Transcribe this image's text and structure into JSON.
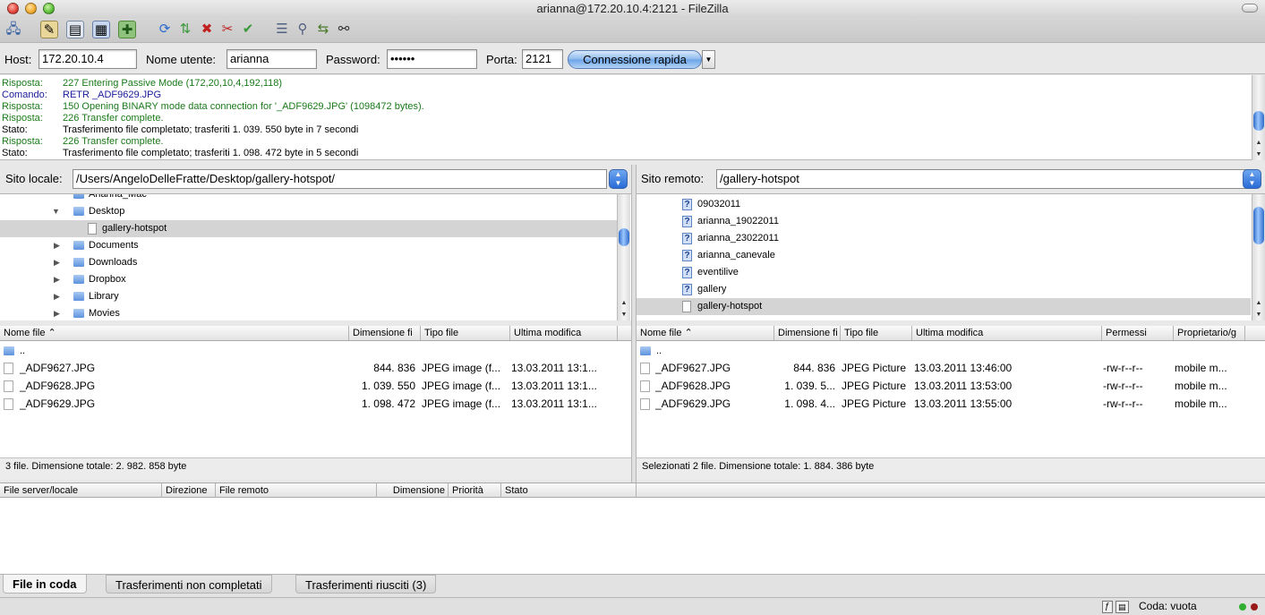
{
  "window": {
    "title": "arianna@172.20.10.4:2121 - FileZilla"
  },
  "quickconnect": {
    "host_label": "Host:",
    "host_value": "172.20.10.4",
    "user_label": "Nome utente:",
    "user_value": "arianna",
    "password_label": "Password:",
    "password_value": "••••••",
    "port_label": "Porta:",
    "port_value": "2121",
    "connect_label": "Connessione rapida"
  },
  "log": [
    {
      "type": "Risposta:",
      "text": "227 Entering Passive Mode (172,20,10,4,192,118)",
      "color": "#1a7a1a"
    },
    {
      "type": "Comando:",
      "text": "RETR _ADF9629.JPG",
      "color": "#1a1a9a"
    },
    {
      "type": "Risposta:",
      "text": "150 Opening BINARY mode data connection for '_ADF9629.JPG' (1098472 bytes).",
      "color": "#1a7a1a"
    },
    {
      "type": "Risposta:",
      "text": "226 Transfer complete.",
      "color": "#1a7a1a"
    },
    {
      "type": "Stato:",
      "text": "Trasferimento file completato; trasferiti 1. 039. 550 byte in 7 secondi",
      "color": "#000000"
    },
    {
      "type": "Risposta:",
      "text": "226 Transfer complete.",
      "color": "#1a7a1a"
    },
    {
      "type": "Stato:",
      "text": "Trasferimento file completato; trasferiti 1. 098. 472 byte in 5 secondi",
      "color": "#000000"
    }
  ],
  "local": {
    "site_label": "Sito locale:",
    "path": "/Users/AngeloDelleFratte/Desktop/gallery-hotspot/",
    "tree": [
      {
        "label": "Arianna_Mac",
        "expanded": null
      },
      {
        "label": "Desktop",
        "expanded": true
      },
      {
        "label": "gallery-hotspot",
        "expanded": null
      },
      {
        "label": "Documents",
        "expanded": false
      },
      {
        "label": "Downloads",
        "expanded": false
      },
      {
        "label": "Dropbox",
        "expanded": false
      },
      {
        "label": "Library",
        "expanded": false
      },
      {
        "label": "Movies",
        "expanded": false
      }
    ],
    "columns": [
      "Nome file",
      "Dimensione fi",
      "Tipo file",
      "Ultima modifica"
    ],
    "parent": "..",
    "files": [
      {
        "name": "_ADF9627.JPG",
        "size": "844. 836",
        "type": "JPEG image (f...",
        "modified": "13.03.2011 13:1..."
      },
      {
        "name": "_ADF9628.JPG",
        "size": "1. 039. 550",
        "type": "JPEG image (f...",
        "modified": "13.03.2011 13:1..."
      },
      {
        "name": "_ADF9629.JPG",
        "size": "1. 098. 472",
        "type": "JPEG image (f...",
        "modified": "13.03.2011 13:1..."
      }
    ],
    "status": "3 file. Dimensione totale: 2. 982. 858 byte"
  },
  "remote": {
    "site_label": "Sito remoto:",
    "path": "/gallery-hotspot",
    "tree": [
      "09032011",
      "arianna_19022011",
      "arianna_23022011",
      "arianna_canevale",
      "eventilive",
      "gallery",
      "gallery-hotspot"
    ],
    "columns": [
      "Nome file",
      "Dimensione fi",
      "Tipo file",
      "Ultima modifica",
      "Permessi",
      "Proprietario/g"
    ],
    "parent": "..",
    "files": [
      {
        "name": "_ADF9627.JPG",
        "size": "844. 836",
        "type": "JPEG Picture",
        "modified": "13.03.2011 13:46:00",
        "perm": "-rw-r--r--",
        "owner": "mobile m..."
      },
      {
        "name": "_ADF9628.JPG",
        "size": "1. 039. 5...",
        "type": "JPEG Picture",
        "modified": "13.03.2011 13:53:00",
        "perm": "-rw-r--r--",
        "owner": "mobile m..."
      },
      {
        "name": "_ADF9629.JPG",
        "size": "1. 098. 4...",
        "type": "JPEG Picture",
        "modified": "13.03.2011 13:55:00",
        "perm": "-rw-r--r--",
        "owner": "mobile m..."
      }
    ],
    "status": "Selezionati 2 file. Dimensione totale: 1. 884. 386 byte"
  },
  "queue": {
    "columns": [
      "File server/locale",
      "Direzione",
      "File remoto",
      "Dimensione",
      "Priorità",
      "Stato"
    ],
    "tabs": [
      "File in coda",
      "Trasferimenti non completati",
      "Trasferimenti riusciti (3)"
    ]
  },
  "statusbar": {
    "queue": "Coda: vuota"
  }
}
